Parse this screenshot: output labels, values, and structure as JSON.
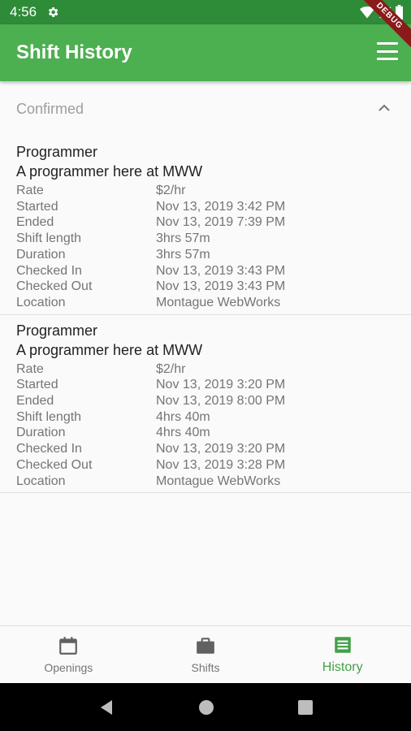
{
  "status_bar": {
    "time": "4:56",
    "debug_label": "DEBUG"
  },
  "app_bar": {
    "title": "Shift History"
  },
  "section": {
    "title": "Confirmed"
  },
  "shifts": [
    {
      "title": "Programmer",
      "description": "A programmer here at MWW",
      "rows": [
        {
          "label": "Rate",
          "value": "$2/hr"
        },
        {
          "label": "Started",
          "value": "Nov 13, 2019 3:42 PM"
        },
        {
          "label": "Ended",
          "value": "Nov 13, 2019 7:39 PM"
        },
        {
          "label": "Shift length",
          "value": "3hrs 57m"
        },
        {
          "label": "Duration",
          "value": "3hrs 57m"
        },
        {
          "label": "Checked In",
          "value": "Nov 13, 2019 3:43 PM"
        },
        {
          "label": "Checked Out",
          "value": "Nov 13, 2019 3:43 PM"
        },
        {
          "label": "Location",
          "value": "Montague WebWorks"
        }
      ]
    },
    {
      "title": "Programmer",
      "description": "A programmer here at MWW",
      "rows": [
        {
          "label": "Rate",
          "value": "$2/hr"
        },
        {
          "label": "Started",
          "value": "Nov 13, 2019 3:20 PM"
        },
        {
          "label": "Ended",
          "value": "Nov 13, 2019 8:00 PM"
        },
        {
          "label": "Shift length",
          "value": "4hrs 40m"
        },
        {
          "label": "Duration",
          "value": "4hrs 40m"
        },
        {
          "label": "Checked In",
          "value": "Nov 13, 2019 3:20 PM"
        },
        {
          "label": "Checked Out",
          "value": "Nov 13, 2019 3:28 PM"
        },
        {
          "label": "Location",
          "value": "Montague WebWorks"
        }
      ]
    }
  ],
  "bottom_nav": {
    "items": [
      {
        "label": "Openings",
        "icon": "calendar-icon",
        "active": false
      },
      {
        "label": "Shifts",
        "icon": "briefcase-icon",
        "active": false
      },
      {
        "label": "History",
        "icon": "list-icon",
        "active": true
      }
    ]
  },
  "colors": {
    "primary": "#4caf50",
    "status_bar": "#2e8b38",
    "active": "#43a047"
  }
}
